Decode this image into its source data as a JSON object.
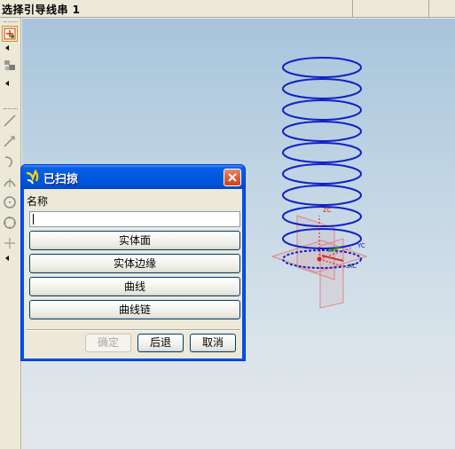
{
  "cue_line": {
    "prompt": "选择引导线串  1"
  },
  "toolbar": {
    "tools": [
      {
        "id": "select-filter",
        "icon": "select-crosshair-icon"
      },
      {
        "id": "view-tools",
        "icon": "view-shapes-icon"
      },
      {
        "id": "line",
        "icon": "line-icon"
      },
      {
        "id": "line-at-angle",
        "icon": "line-arrow-icon"
      },
      {
        "id": "curve-hook",
        "icon": "hook-curve-icon"
      },
      {
        "id": "arc",
        "icon": "arc-icon"
      },
      {
        "id": "circle",
        "icon": "circle-icon"
      },
      {
        "id": "circle-tangent",
        "icon": "circle-tangent-icon"
      },
      {
        "id": "point",
        "icon": "point-plus-icon"
      }
    ]
  },
  "graphics": {
    "wcs_labels": {
      "zc": "ZC",
      "yc": "YC",
      "xc": "XC"
    },
    "colors": {
      "helix": "#1020c8",
      "datum_plane": "#e08585",
      "wcs": "#d22020"
    }
  },
  "dialog": {
    "title": "已扫掠",
    "name_label": "名称",
    "name_value": "",
    "options": [
      {
        "label": "实体面"
      },
      {
        "label": "实体边缘"
      },
      {
        "label": "曲线"
      },
      {
        "label": "曲线链"
      }
    ],
    "buttons": {
      "ok": "确定",
      "back": "后退",
      "cancel": "取消"
    },
    "ok_enabled": false
  }
}
